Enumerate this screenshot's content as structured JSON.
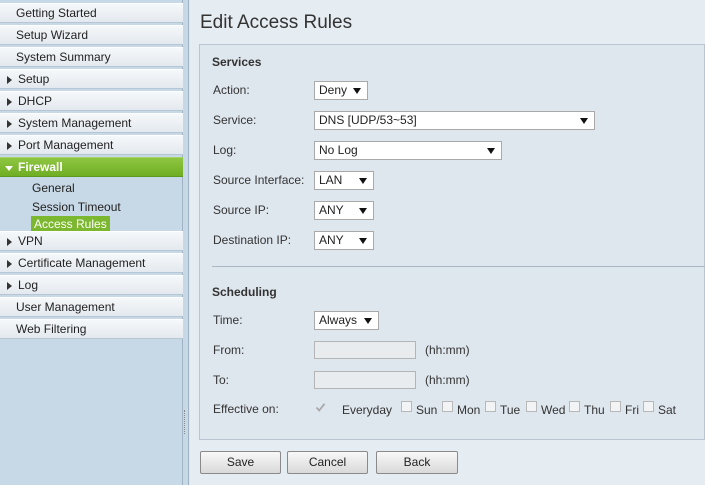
{
  "sidebar": {
    "items": [
      {
        "label": "Getting Started"
      },
      {
        "label": "Setup Wizard"
      },
      {
        "label": "System Summary"
      },
      {
        "label": "Setup"
      },
      {
        "label": "DHCP"
      },
      {
        "label": "System Management"
      },
      {
        "label": "Port Management"
      },
      {
        "label": "Firewall"
      },
      {
        "label": "VPN"
      },
      {
        "label": "Certificate Management"
      },
      {
        "label": "Log"
      },
      {
        "label": "User Management"
      },
      {
        "label": "Web Filtering"
      }
    ],
    "firewall_sub": [
      {
        "label": "General"
      },
      {
        "label": "Session Timeout"
      },
      {
        "label": "Access Rules"
      }
    ]
  },
  "page": {
    "title": "Edit Access Rules"
  },
  "services": {
    "title": "Services",
    "action": {
      "label": "Action:",
      "value": "Deny"
    },
    "service": {
      "label": "Service:",
      "value": "DNS [UDP/53~53]"
    },
    "log": {
      "label": "Log:",
      "value": "No Log"
    },
    "source_interface": {
      "label": "Source Interface:",
      "value": "LAN"
    },
    "source_ip": {
      "label": "Source IP:",
      "value": "ANY"
    },
    "destination_ip": {
      "label": "Destination IP:",
      "value": "ANY"
    }
  },
  "scheduling": {
    "title": "Scheduling",
    "time": {
      "label": "Time:",
      "value": "Always"
    },
    "from": {
      "label": "From:",
      "value": "",
      "hint": "(hh:mm)"
    },
    "to": {
      "label": "To:",
      "value": "",
      "hint": "(hh:mm)"
    },
    "effective_on": {
      "label": "Effective on:",
      "days": [
        {
          "label": "Everyday",
          "checked": true
        },
        {
          "label": "Sun",
          "checked": false
        },
        {
          "label": "Mon",
          "checked": false
        },
        {
          "label": "Tue",
          "checked": false
        },
        {
          "label": "Wed",
          "checked": false
        },
        {
          "label": "Thu",
          "checked": false
        },
        {
          "label": "Fri",
          "checked": false
        },
        {
          "label": "Sat",
          "checked": false
        }
      ]
    }
  },
  "buttons": {
    "save": "Save",
    "cancel": "Cancel",
    "back": "Back"
  },
  "colors": {
    "active_nav": "#7cb82f",
    "sidebar_bg": "#c7d8e6"
  }
}
